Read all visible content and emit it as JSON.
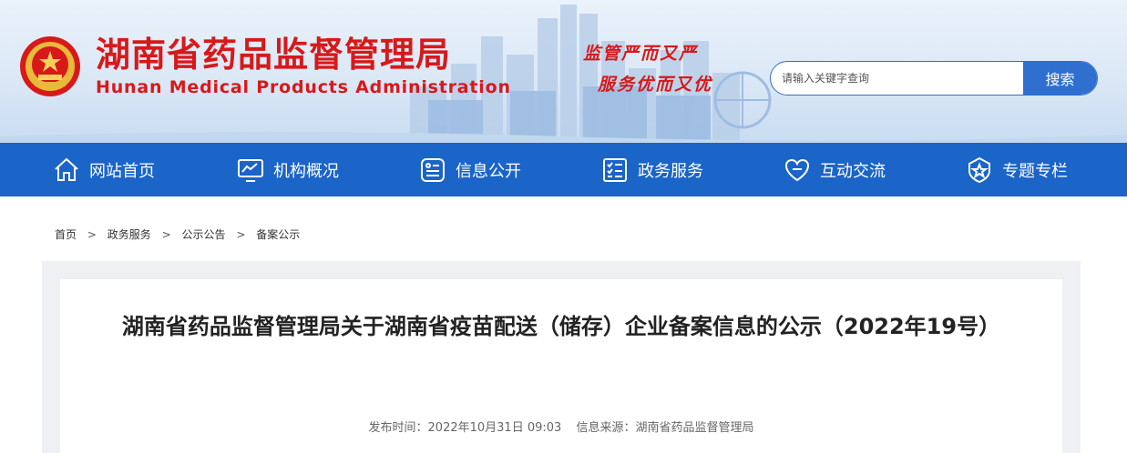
{
  "header": {
    "title_cn": "湖南省药品监督管理局",
    "title_en": "Hunan Medical Products Administration",
    "slogan_line1": "监管严而又严",
    "slogan_line2": "服务优而又优",
    "search": {
      "placeholder": "请输入关键字查询",
      "button_label": "搜索"
    }
  },
  "nav": {
    "items": [
      {
        "label": "网站首页",
        "icon": "home-icon"
      },
      {
        "label": "机构概况",
        "icon": "monitor-chart-icon"
      },
      {
        "label": "信息公开",
        "icon": "document-icon"
      },
      {
        "label": "政务服务",
        "icon": "checklist-icon"
      },
      {
        "label": "互动交流",
        "icon": "heart-chat-icon"
      },
      {
        "label": "专题专栏",
        "icon": "star-shield-icon"
      }
    ]
  },
  "breadcrumb": {
    "items": [
      "首页",
      "政务服务",
      "公示公告",
      "备案公示"
    ],
    "separator": ">"
  },
  "article": {
    "title": "湖南省药品监督管理局关于湖南省疫苗配送（储存）企业备案信息的公示（2022年19号）",
    "publish_time": "发布时间：2022年10月31日 09:03",
    "source": "信息来源：湖南省药品监督管理局"
  },
  "colors": {
    "brand_red": "#d7191a",
    "nav_blue": "#1b64c8",
    "search_blue": "#2f6fcf"
  }
}
